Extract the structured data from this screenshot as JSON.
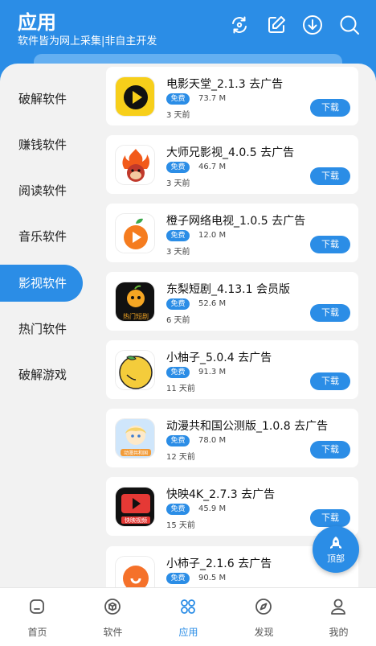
{
  "header": {
    "title": "应用",
    "subtitle": "软件皆为网上采集|非自主开发",
    "icons": [
      "refresh-icon",
      "edit-icon",
      "download-icon",
      "search-icon"
    ]
  },
  "sidebar": {
    "items": [
      {
        "label": "破解软件"
      },
      {
        "label": "赚钱软件"
      },
      {
        "label": "阅读软件"
      },
      {
        "label": "音乐软件"
      },
      {
        "label": "影视软件",
        "active": true
      },
      {
        "label": "热门软件"
      },
      {
        "label": "破解游戏"
      }
    ]
  },
  "apps": [
    {
      "name": "电影天堂_2.1.3 去广告",
      "badge": "免费",
      "size": "73.7 M",
      "time": "3 天前",
      "button": "下载"
    },
    {
      "name": "大师兄影视_4.0.5 去广告",
      "badge": "免费",
      "size": "46.7 M",
      "time": "3 天前",
      "button": "下载"
    },
    {
      "name": "橙子网络电视_1.0.5 去广告",
      "badge": "免费",
      "size": "12.0 M",
      "time": "3 天前",
      "button": "下载"
    },
    {
      "name": "东梨短剧_4.13.1 会员版",
      "badge": "免费",
      "size": "52.6 M",
      "time": "6 天前",
      "button": "下载",
      "icon_text": "热门短剧"
    },
    {
      "name": "小柚子_5.0.4 去广告",
      "badge": "免费",
      "size": "91.3 M",
      "time": "11 天前",
      "button": "下载"
    },
    {
      "name": "动漫共和国公测版_1.0.8 去广告",
      "badge": "免费",
      "size": "78.0 M",
      "time": "12 天前",
      "button": "下载",
      "icon_text": "动漫共和国"
    },
    {
      "name": "快映4K_2.7.3 去广告",
      "badge": "免费",
      "size": "45.9 M",
      "time": "15 天前",
      "button": "下载",
      "icon_text": "快映视频"
    },
    {
      "name": "小柿子_2.1.6 去广告",
      "badge": "免费",
      "size": "90.5 M",
      "time": "",
      "button": ""
    }
  ],
  "fab": {
    "label": "顶部"
  },
  "tabbar": {
    "tabs": [
      {
        "label": "首页",
        "icon": "home-icon"
      },
      {
        "label": "软件",
        "icon": "cube-icon"
      },
      {
        "label": "应用",
        "icon": "apps-icon",
        "active": true
      },
      {
        "label": "发现",
        "icon": "compass-icon"
      },
      {
        "label": "我的",
        "icon": "user-icon"
      }
    ]
  },
  "colors": {
    "accent": "#2b8de6",
    "background": "#f2f2f2"
  }
}
